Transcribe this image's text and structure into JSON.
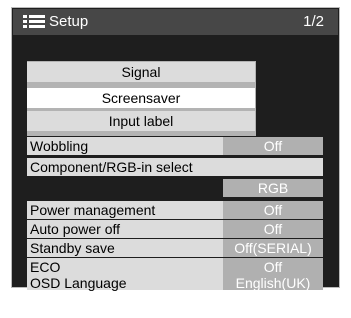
{
  "header": {
    "icon": "menu-list-icon",
    "title": "Setup",
    "page": "1/2"
  },
  "submenu": {
    "items": [
      {
        "label": "Signal",
        "selected": false
      },
      {
        "label": "Screensaver",
        "selected": true
      },
      {
        "label": "Input label",
        "selected": false
      }
    ]
  },
  "settings": [
    {
      "label": "Wobbling",
      "value": "Off"
    },
    {
      "label": "Component/RGB-in select",
      "value": ""
    },
    {
      "label": "",
      "value": "RGB"
    },
    {
      "label": "Power management",
      "value": "Off"
    },
    {
      "label": "Auto power off",
      "value": "Off"
    },
    {
      "label": "Standby save",
      "value": "Off(SERIAL)"
    },
    {
      "label": "ECO",
      "value": "Off"
    },
    {
      "label": "OSD Language",
      "value": "English(UK)"
    }
  ],
  "colors": {
    "panel_bg": "#1e1e1e",
    "title_bar": "#474747",
    "row_bg": "#dcdcdc",
    "value_bg": "#b0b0b0",
    "selected_bg": "#ffffff"
  }
}
